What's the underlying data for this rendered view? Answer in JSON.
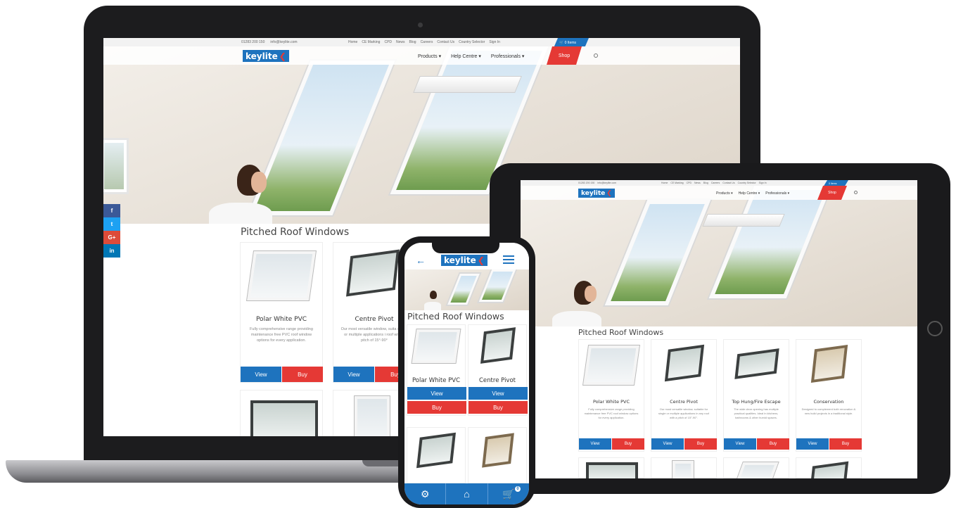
{
  "brand": {
    "logo_text": "keylite",
    "primary": "#1e73be",
    "accent": "#e53935"
  },
  "topbar": {
    "phone": "01283 200 150",
    "email": "info@keylite.com",
    "links": [
      "Home",
      "CE Marking",
      "CPD",
      "News",
      "Blog",
      "Careers",
      "Contact Us",
      "Country Selector",
      "Sign In"
    ],
    "basket": "0 Items"
  },
  "nav": {
    "items": [
      "Products",
      "Help Centre",
      "Professionals"
    ],
    "shop": "Shop"
  },
  "section_title": "Pitched Roof Windows",
  "products": [
    {
      "name": "Polar White PVC",
      "desc": "Fully comprehensive range providing maintenance free PVC roof window options for every application."
    },
    {
      "name": "Centre Pivot",
      "desc": "Our most versatile window, suitable for single or multiple applications in any roof with a pitch of 15°-90°."
    },
    {
      "name": "Top Hung/Fire Escape",
      "desc": "The wide clear opening has multiple practical qualities. Ideal in kitchens, bathrooms & other humid spaces."
    },
    {
      "name": "Conservation",
      "desc": "Designed to complement both renovation & new build projects in a traditional style."
    }
  ],
  "laptop_desc_2": "Our most versatile window, suita single or multiple applications i roof with a pitch of 15°-90°",
  "buttons": {
    "view": "View",
    "buy": "Buy"
  },
  "social": [
    "f",
    "t",
    "G+",
    "in"
  ],
  "phone": {
    "cart_count": "0"
  }
}
